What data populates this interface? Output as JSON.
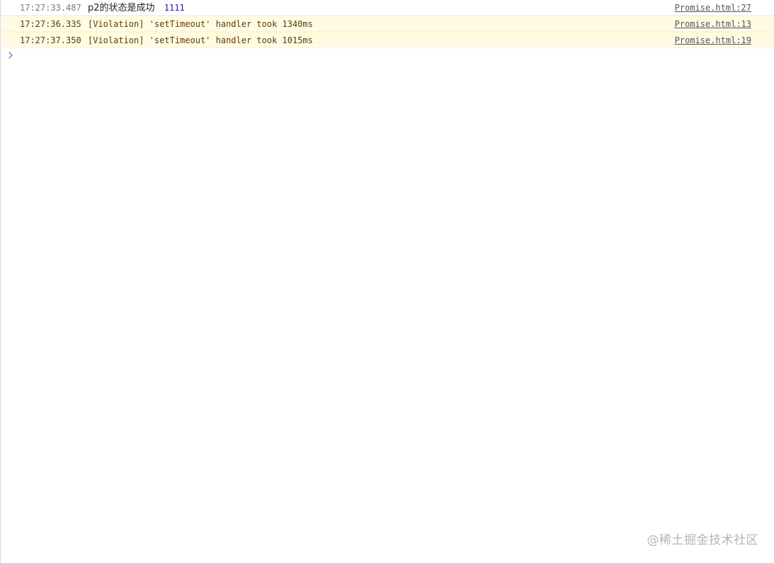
{
  "console": {
    "rows": [
      {
        "timestamp": "17:27:33.487",
        "message": "p2的状态是成功",
        "value": "1111",
        "source": "Promise.html:27",
        "level": "info"
      },
      {
        "timestamp": "17:27:36.335",
        "message": "[Violation] 'setTimeout' handler took 1340ms",
        "source": "Promise.html:13",
        "level": "violation"
      },
      {
        "timestamp": "17:27:37.350",
        "message": "[Violation] 'setTimeout' handler took 1015ms",
        "source": "Promise.html:19",
        "level": "violation"
      }
    ],
    "prompt_icon": "chevron-right-icon",
    "colors": {
      "violation_background": "#fffbe5",
      "violation_text": "#5c3b00",
      "number_value": "#1a1aa6",
      "prompt_icon": "#4a90d9"
    }
  },
  "watermark": "@稀土掘金技术社区"
}
